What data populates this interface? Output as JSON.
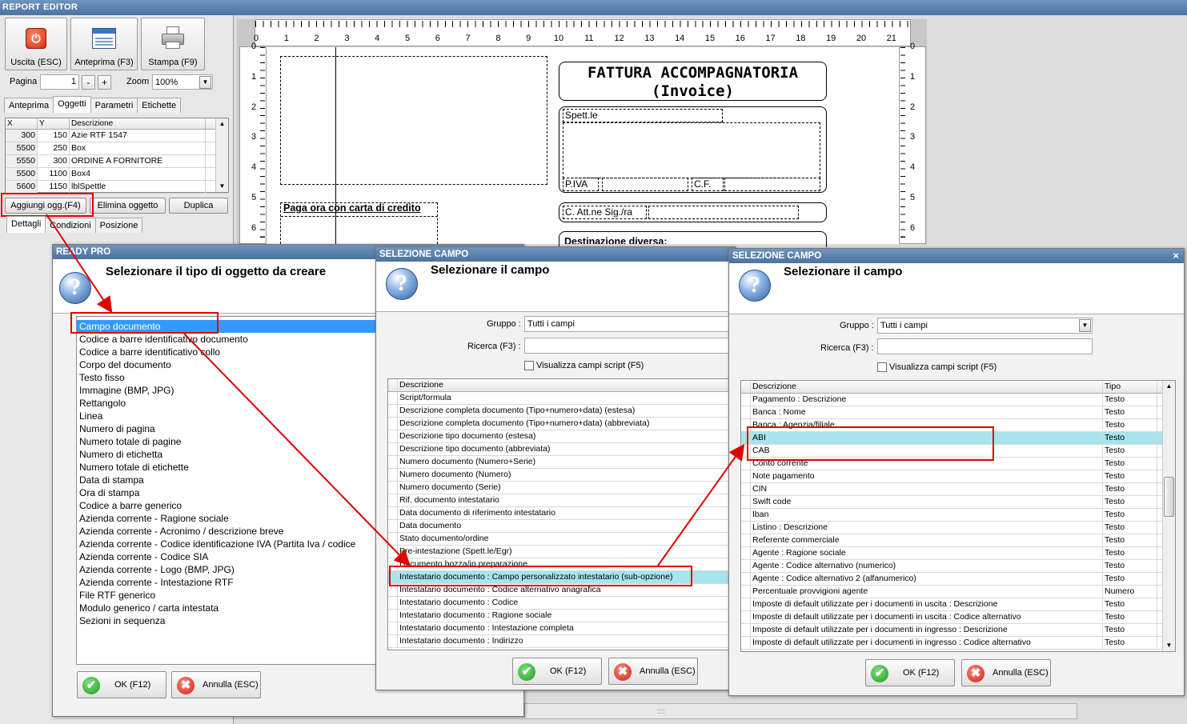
{
  "app_title": "REPORT EDITOR",
  "toolbar": {
    "exit_label": "Uscita (ESC)",
    "preview_label": "Anteprima (F3)",
    "print_label": "Stampa (F9)",
    "page_label": "Pagina",
    "page_value": "1",
    "minus": "-",
    "plus": "+",
    "zoom_label": "Zoom",
    "zoom_value": "100%"
  },
  "left_tabs": [
    "Anteprima",
    "Oggetti",
    "Parametri",
    "Etichette"
  ],
  "object_grid": {
    "headers": [
      "X",
      "Y",
      "Descrizione"
    ],
    "rows": [
      [
        "300",
        "150",
        "Azie RTF 1547"
      ],
      [
        "5500",
        "250",
        "Box"
      ],
      [
        "5550",
        "300",
        "ORDINE A FORNITORE"
      ],
      [
        "5500",
        "1100",
        "Box4"
      ],
      [
        "5600",
        "1150",
        "lblSpettle"
      ]
    ]
  },
  "object_buttons": {
    "add": "Aggiungi ogg.(F4)",
    "delete": "Elimina oggetto",
    "duplicate": "Duplica"
  },
  "detail_tabs": [
    "Dettagli",
    "Condizioni",
    "Posizione"
  ],
  "ruler": {
    "top": [
      "0",
      "1",
      "2",
      "3",
      "4",
      "5",
      "6",
      "7",
      "8",
      "9",
      "10",
      "11",
      "12",
      "13",
      "14",
      "15",
      "16",
      "17",
      "18",
      "19",
      "20",
      "21"
    ],
    "side": [
      "0",
      "1",
      "2",
      "3",
      "4",
      "5",
      "6"
    ]
  },
  "paper": {
    "invoice_title": "FATTURA ACCOMPAGNATORIA",
    "invoice_subtitle": "(Invoice)",
    "spett": "Spett.le",
    "piva": "P.IVA",
    "cf": "C.F.",
    "attn": "C. Att.ne Sig./ra",
    "pay_online": "Paga ora con carta di credito",
    "dest": "Destinazione diversa:"
  },
  "dialog1": {
    "title": "READY PRO",
    "heading": "Selezionare il tipo di oggetto da creare",
    "items": [
      "Campo documento",
      "Codice a barre identificativo documento",
      "Codice a barre identificativo collo",
      "Corpo del documento",
      "Testo fisso",
      "Immagine (BMP, JPG)",
      "Rettangolo",
      "Linea",
      "Numero di pagina",
      "Numero totale di pagine",
      "Numero di etichetta",
      "Numero totale di etichette",
      "Data di stampa",
      "Ora di stampa",
      "Codice a barre generico",
      "Azienda corrente - Ragione sociale",
      "Azienda corrente - Acronimo / descrizione breve",
      "Azienda corrente - Codice identificazione IVA (Partita Iva / codice",
      "Azienda corrente - Codice SIA",
      "Azienda corrente - Logo (BMP, JPG)",
      "Azienda corrente - Intestazione RTF",
      "File RTF generico",
      "Modulo generico / carta intestata",
      "Sezioni in sequenza"
    ],
    "ok": "OK (F12)",
    "cancel": "Annulla (ESC)"
  },
  "dialog2": {
    "title": "SELEZIONE CAMPO",
    "heading": "Selezionare il campo",
    "group_label": "Gruppo :",
    "group_value": "Tutti i campi",
    "search_label": "Ricerca (F3) :",
    "script_label": "Visualizza campi script (F5)",
    "col_desc": "Descrizione",
    "rows": [
      "Script/formula",
      "Descrizione completa documento (Tipo+numero+data) (estesa)",
      "Descrizione completa documento (Tipo+numero+data) (abbreviata)",
      "Descrizione tipo documento (estesa)",
      "Descrizione tipo documento (abbreviata)",
      "Numero documento (Numero+Serie)",
      "Numero documento (Numero)",
      "Numero documento (Serie)",
      "Rif. documento intestatario",
      "Data documento di riferimento intestatario",
      "Data documento",
      "Stato documento/ordine",
      "Pre-intestazione (Spett.le/Egr)",
      "Documento bozza/in preparazione",
      "Intestatario documento : Campo personalizzato intestatario (sub-opzione)",
      "Intestatario documento : Codice alternativo anagrafica",
      "Intestatario documento : Codice",
      "Intestatario documento : Ragione sociale",
      "Intestatario documento : Intestazione completa",
      "Intestatario documento : Indirizzo"
    ],
    "ok": "OK (F12)",
    "cancel": "Annulla (ESC)"
  },
  "dialog3": {
    "title": "SELEZIONE CAMPO",
    "close": "×",
    "heading": "Selezionare il campo",
    "group_label": "Gruppo :",
    "group_value": "Tutti i campi",
    "search_label": "Ricerca (F3) :",
    "script_label": "Visualizza campi script (F5)",
    "col_desc": "Descrizione",
    "col_type": "Tipo",
    "rows": [
      [
        "Pagamento : Descrizione",
        "Testo"
      ],
      [
        "Banca : Nome",
        "Testo"
      ],
      [
        "Banca : Agenzia/filiale",
        "Testo"
      ],
      [
        "ABI",
        "Testo"
      ],
      [
        "CAB",
        "Testo"
      ],
      [
        "Conto corrente",
        "Testo"
      ],
      [
        "Note pagamento",
        "Testo"
      ],
      [
        "CIN",
        "Testo"
      ],
      [
        "Swift code",
        "Testo"
      ],
      [
        "Iban",
        "Testo"
      ],
      [
        "Listino : Descrizione",
        "Testo"
      ],
      [
        "Referente commerciale",
        "Testo"
      ],
      [
        "Agente : Ragione sociale",
        "Testo"
      ],
      [
        "Agente : Codice alternativo (numerico)",
        "Testo"
      ],
      [
        "Agente : Codice alternativo 2 (alfanumerico)",
        "Testo"
      ],
      [
        "Percentuale provvigioni agente",
        "Numero"
      ],
      [
        "Imposte di default utilizzate per i documenti in uscita : Descrizione",
        "Testo"
      ],
      [
        "Imposte di default utilizzate per i documenti in uscita : Codice alternativo",
        "Testo"
      ],
      [
        "Imposte di default utilizzate per i documenti in ingresso : Descrizione",
        "Testo"
      ],
      [
        "Imposte di default utilizzate per i documenti in ingresso : Codice alternativo",
        "Testo"
      ]
    ],
    "ok": "OK (F12)",
    "cancel": "Annulla (ESC)"
  },
  "colors": {
    "title_bar": "#4c72a0",
    "highlight_box": "#e00000",
    "selected_row": "#a7e4ee",
    "selected_item": "#3399ff"
  }
}
